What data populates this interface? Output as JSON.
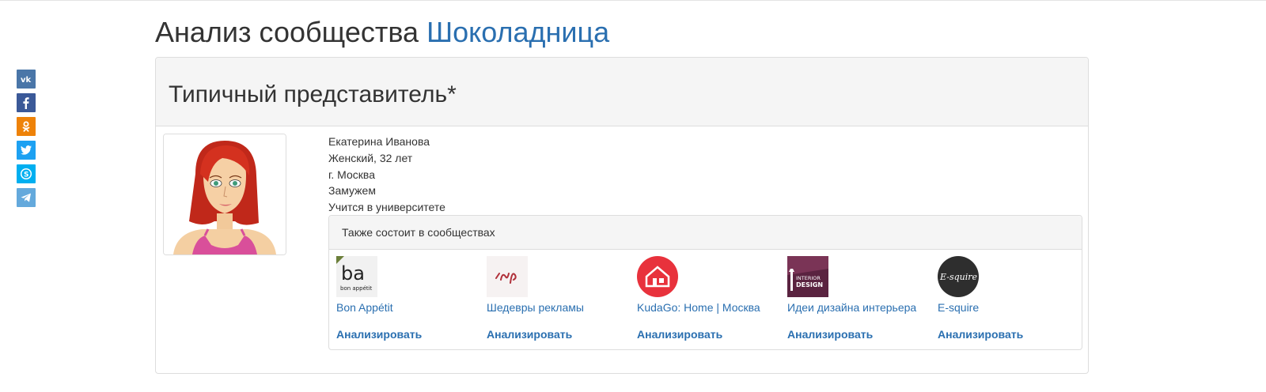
{
  "page": {
    "title_prefix": "Анализ сообщества",
    "title_link": "Шоколадница"
  },
  "share": [
    {
      "icon": "vk-icon",
      "color": "#4a76a8"
    },
    {
      "icon": "facebook-icon",
      "color": "#3b5998"
    },
    {
      "icon": "odnoklassniki-icon",
      "color": "#ee8208"
    },
    {
      "icon": "twitter-icon",
      "color": "#1da1f2"
    },
    {
      "icon": "skype-icon",
      "color": "#00aff0"
    },
    {
      "icon": "telegram-icon",
      "color": "#64a9dc"
    }
  ],
  "panel": {
    "heading": "Типичный представитель*"
  },
  "profile": {
    "name": "Екатерина Иванова",
    "gender_age": "Женский, 32 лет",
    "city": "г. Москва",
    "marital": "Замужем",
    "education": "Учится в университете"
  },
  "communities": {
    "heading": "Также состоит в сообществах",
    "items": [
      {
        "name": "Bon Appétit",
        "logo_text": "ba",
        "logo_subtext": "bon appétit",
        "action": "Анализировать"
      },
      {
        "name": "Шедевры рекламы",
        "logo_text": "",
        "action": "Анализировать"
      },
      {
        "name": "KudaGo: Home | Москва",
        "logo_text": "",
        "action": "Анализировать"
      },
      {
        "name": "Идеи дизайна интерьера",
        "logo_text": "INTERIOR",
        "logo_subtext": "DESIGN",
        "action": "Анализировать"
      },
      {
        "name": "E-squire",
        "logo_text": "E-squire",
        "action": "Анализировать"
      }
    ]
  },
  "colors": {
    "link": "#2a6fb0",
    "panel_bg": "#f5f5f5",
    "border": "#dddddd"
  }
}
